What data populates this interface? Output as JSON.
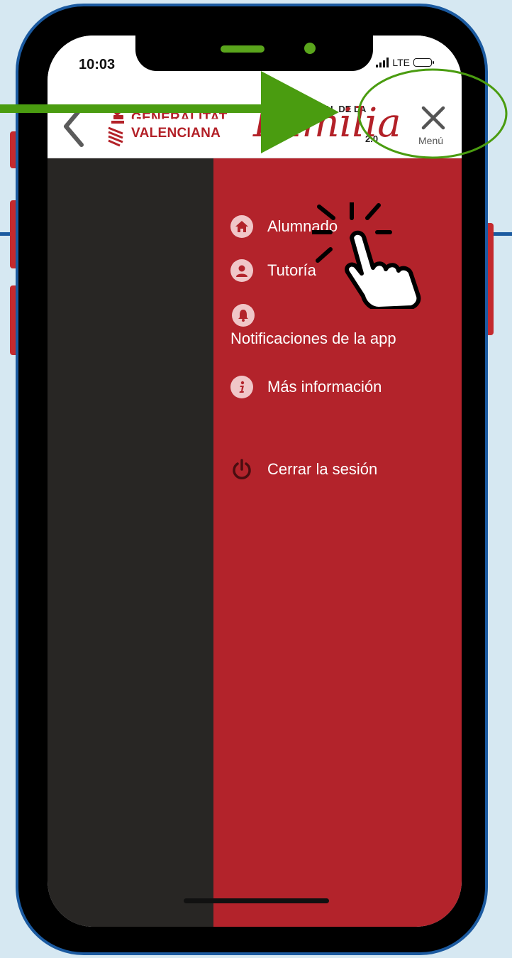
{
  "status_bar": {
    "time": "10:03",
    "network": "LTE"
  },
  "header": {
    "org_name_line1": "GENERALITAT",
    "org_name_line2": "VALENCIANA",
    "app_logo_prefix": "OFICIAL DE LA",
    "app_logo_script": "Familia",
    "app_logo_version": "2.0",
    "close_label": "Menú"
  },
  "menu": {
    "items": [
      {
        "label": "Alumnado",
        "icon": "home-icon"
      },
      {
        "label": "Tutoría",
        "icon": "user-icon"
      },
      {
        "label": "Notificaciones de la app",
        "icon": "bell-icon"
      },
      {
        "label": "Más información",
        "icon": "info-icon"
      },
      {
        "label": "Cerrar la sesión",
        "icon": "power-icon"
      }
    ]
  },
  "colors": {
    "menu_bg": "#b3232b",
    "overlay_bg": "#282624",
    "annotation_green": "#4a9c10",
    "frame_blue": "#1b5aa0"
  }
}
